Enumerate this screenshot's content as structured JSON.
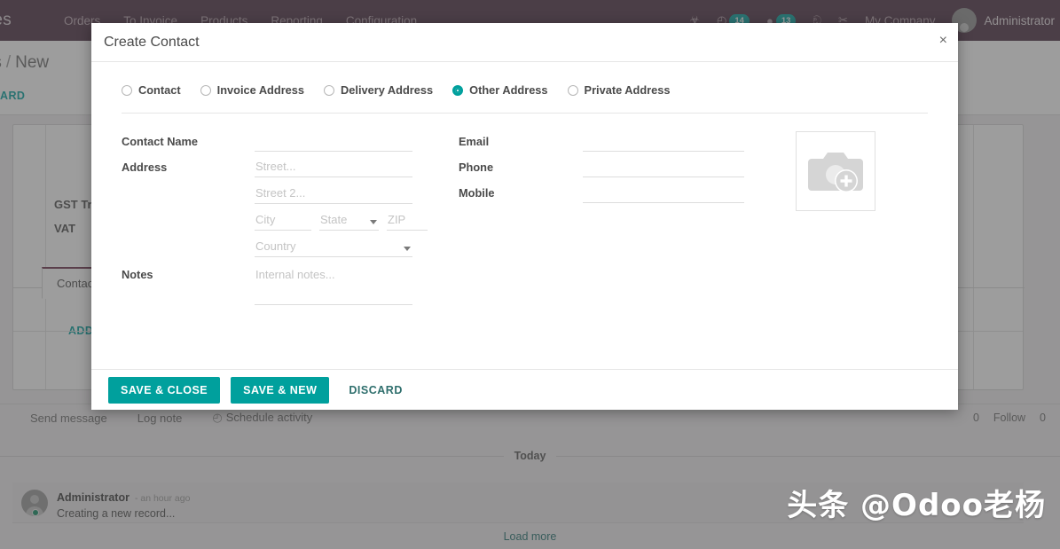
{
  "navbar": {
    "brand": "les",
    "menu": [
      {
        "label": "Orders"
      },
      {
        "label": "To Invoice"
      },
      {
        "label": "Products"
      },
      {
        "label": "Reporting"
      },
      {
        "label": "Configuration"
      }
    ],
    "icons": [
      {
        "name": "bug-icon",
        "glyph": "☣",
        "badge": ""
      },
      {
        "name": "clock-icon",
        "glyph": "◴",
        "badge": "14"
      },
      {
        "name": "chat-icon",
        "glyph": "●",
        "badge": "13"
      },
      {
        "name": "people-icon",
        "glyph": "ඞ",
        "badge": ""
      },
      {
        "name": "settings-icon",
        "glyph": "✂",
        "badge": ""
      }
    ],
    "company": "My Company",
    "username": "Administrator"
  },
  "control_panel": {
    "breadcrumb_root": "rs",
    "breadcrumb_sep": "/",
    "breadcrumb_current": "New",
    "discard_button": "ISCARD"
  },
  "background_sheet": {
    "label_gst": "GST Treat",
    "label_vat": "VAT",
    "tab_contacts": "Contact",
    "add_link": "ADD"
  },
  "chatter": {
    "send_message": "Send message",
    "log_note": "Log note",
    "schedule_activity": "Schedule activity",
    "attachment_count": "0",
    "follow_label": "Follow",
    "follower_count": "0",
    "today_label": "Today",
    "message": {
      "author": "Administrator",
      "time": "- an hour ago",
      "text": "Creating a new record..."
    },
    "load_more": "Load more"
  },
  "modal": {
    "title": "Create Contact",
    "close_glyph": "×",
    "address_types": [
      {
        "label": "Contact",
        "checked": false
      },
      {
        "label": "Invoice Address",
        "checked": false
      },
      {
        "label": "Delivery Address",
        "checked": false
      },
      {
        "label": "Other Address",
        "checked": true
      },
      {
        "label": "Private Address",
        "checked": false
      }
    ],
    "fields": {
      "contact_name_label": "Contact Name",
      "contact_name_value": "",
      "contact_name_placeholder": "",
      "address_label": "Address",
      "street_placeholder": "Street...",
      "street_value": "",
      "street2_placeholder": "Street 2...",
      "street2_value": "",
      "city_placeholder": "City",
      "city_value": "",
      "state_placeholder": "State",
      "state_value": "",
      "zip_placeholder": "ZIP",
      "zip_value": "",
      "country_placeholder": "Country",
      "country_value": "",
      "notes_label": "Notes",
      "notes_placeholder": "Internal notes...",
      "notes_value": "",
      "email_label": "Email",
      "email_value": "",
      "phone_label": "Phone",
      "phone_value": "",
      "mobile_label": "Mobile",
      "mobile_value": ""
    },
    "image_upload": {
      "icon": "camera-add-icon"
    },
    "footer": {
      "save_close": "SAVE & CLOSE",
      "save_new": "SAVE & NEW",
      "discard": "DISCARD"
    }
  },
  "watermark": "头条 @Odoo老杨",
  "colors": {
    "navbar_bg": "#4b2e41",
    "accent": "#00a09d",
    "badge": "#00a09d",
    "link": "#2f6f6d"
  }
}
